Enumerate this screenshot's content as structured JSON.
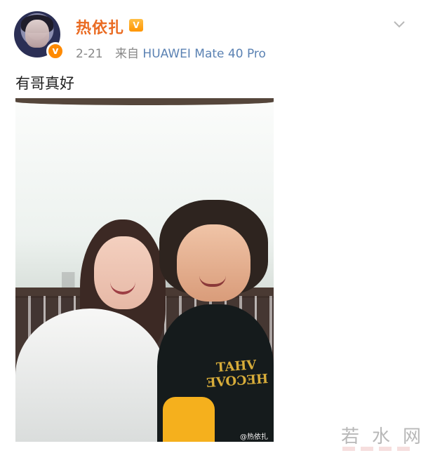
{
  "post": {
    "username": "热依扎",
    "vip_icon_text": "V",
    "verified_text": "v",
    "timestamp": "2-21",
    "source_prefix": "来自",
    "device": "HUAWEI Mate 40 Pro",
    "text": "有哥真好",
    "image_watermark": "@热依扎"
  },
  "page_watermark": {
    "chars": [
      "若",
      "水",
      "网"
    ]
  },
  "icons": {
    "expand": "chevron-down-icon",
    "verified": "verified-icon",
    "vip": "vip-icon"
  },
  "colors": {
    "username": "#ea6b22",
    "meta": "#888888",
    "device": "#5b82b3",
    "verified": "#ff8a00"
  }
}
